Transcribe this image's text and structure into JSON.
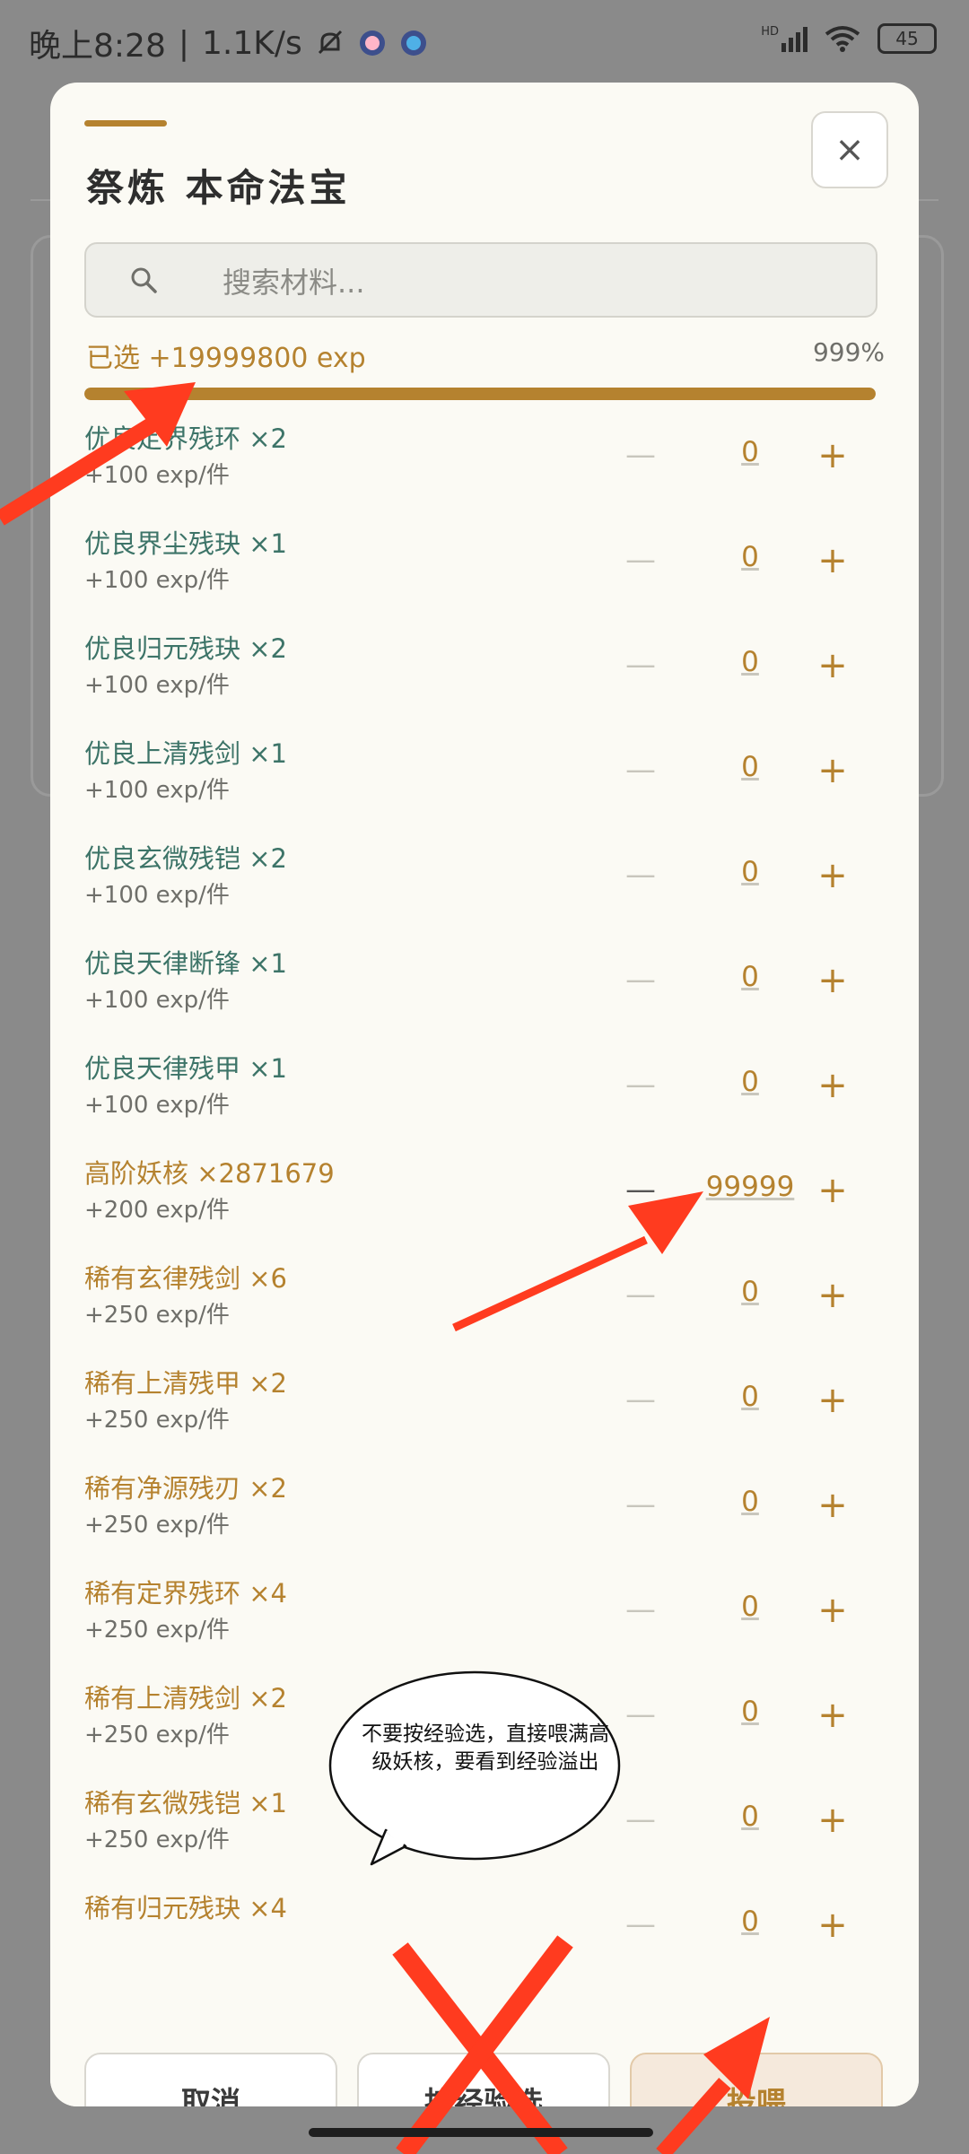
{
  "status": {
    "time": "晚上8:28",
    "speed": "1.1K/s",
    "net": "HD",
    "battery": "45"
  },
  "dialog": {
    "title": "祭炼 本命法宝",
    "close_label": "×",
    "search_placeholder": "搜索材料...",
    "selected_label": "已选 +19999800 exp",
    "percent_label": "999%",
    "progress_fraction": 1.0
  },
  "materials": [
    {
      "name": "优良定界残环 ×2",
      "exp": "+100 exp/件",
      "qty": "0",
      "tier": "good",
      "minus": "—",
      "plus": "+"
    },
    {
      "name": "优良界尘残玦 ×1",
      "exp": "+100 exp/件",
      "qty": "0",
      "tier": "good",
      "minus": "—",
      "plus": "+"
    },
    {
      "name": "优良归元残玦 ×2",
      "exp": "+100 exp/件",
      "qty": "0",
      "tier": "good",
      "minus": "—",
      "plus": "+"
    },
    {
      "name": "优良上清残剑 ×1",
      "exp": "+100 exp/件",
      "qty": "0",
      "tier": "good",
      "minus": "—",
      "plus": "+"
    },
    {
      "name": "优良玄微残铠 ×2",
      "exp": "+100 exp/件",
      "qty": "0",
      "tier": "good",
      "minus": "—",
      "plus": "+"
    },
    {
      "name": "优良天律断锋 ×1",
      "exp": "+100 exp/件",
      "qty": "0",
      "tier": "good",
      "minus": "—",
      "plus": "+"
    },
    {
      "name": "优良天律残甲 ×1",
      "exp": "+100 exp/件",
      "qty": "0",
      "tier": "good",
      "minus": "—",
      "plus": "+"
    },
    {
      "name": "高阶妖核 ×2871679",
      "exp": "+200 exp/件",
      "qty": "99999",
      "tier": "rare",
      "minus": "—",
      "plus": "+"
    },
    {
      "name": "稀有玄律残剑 ×6",
      "exp": "+250 exp/件",
      "qty": "0",
      "tier": "rare",
      "minus": "—",
      "plus": "+"
    },
    {
      "name": "稀有上清残甲 ×2",
      "exp": "+250 exp/件",
      "qty": "0",
      "tier": "rare",
      "minus": "—",
      "plus": "+"
    },
    {
      "name": "稀有净源残刃 ×2",
      "exp": "+250 exp/件",
      "qty": "0",
      "tier": "rare",
      "minus": "—",
      "plus": "+"
    },
    {
      "name": "稀有定界残环 ×4",
      "exp": "+250 exp/件",
      "qty": "0",
      "tier": "rare",
      "minus": "—",
      "plus": "+"
    },
    {
      "name": "稀有上清残剑 ×2",
      "exp": "+250 exp/件",
      "qty": "0",
      "tier": "rare",
      "minus": "—",
      "plus": "+"
    },
    {
      "name": "稀有玄微残铠 ×1",
      "exp": "+250 exp/件",
      "qty": "0",
      "tier": "rare",
      "minus": "—",
      "plus": "+"
    },
    {
      "name": "稀有归元残玦 ×4",
      "exp": "",
      "qty": "0",
      "tier": "rare",
      "minus": "—",
      "plus": "+"
    }
  ],
  "footer": {
    "cancel": "取消",
    "by_exp": "按经验选",
    "feed": "投喂"
  },
  "annotation": {
    "bubble": "不要按经验选，直接喂满高级妖核，要看到经验溢出"
  },
  "colors": {
    "accent": "#b5822f",
    "good": "#3d7468",
    "annotation_red": "#ff3b1f"
  }
}
